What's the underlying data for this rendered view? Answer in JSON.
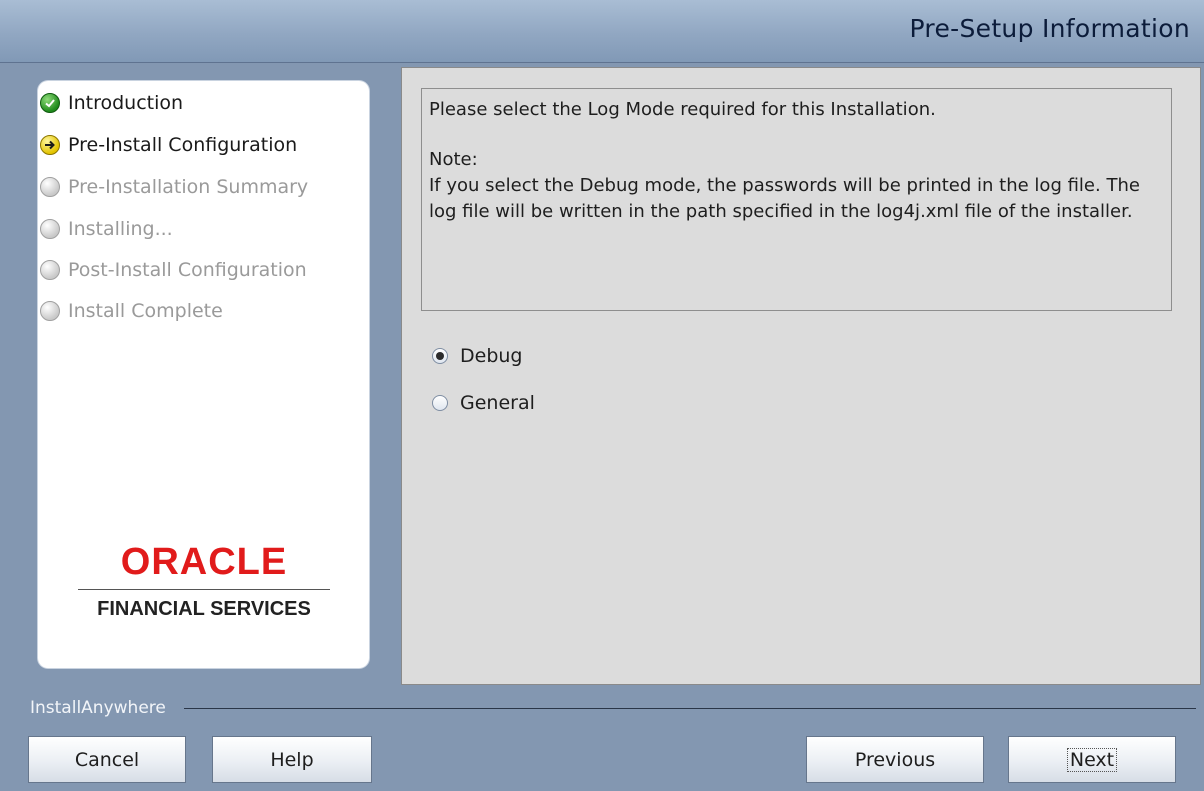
{
  "header": {
    "title": "Pre-Setup Information"
  },
  "steps": [
    {
      "label": "Introduction",
      "state": "done",
      "icon": "check-circle-icon"
    },
    {
      "label": "Pre-Install Configuration",
      "state": "current",
      "icon": "arrow-circle-icon"
    },
    {
      "label": "Pre-Installation Summary",
      "state": "pending",
      "icon": "empty-circle-icon"
    },
    {
      "label": "Installing...",
      "state": "pending",
      "icon": "empty-circle-icon"
    },
    {
      "label": "Post-Install Configuration",
      "state": "pending",
      "icon": "empty-circle-icon"
    },
    {
      "label": "Install Complete",
      "state": "pending",
      "icon": "empty-circle-icon"
    }
  ],
  "logo": {
    "brand": "ORACLE",
    "sub": "FINANCIAL SERVICES"
  },
  "info": {
    "line1": "Please select the Log Mode required for this Installation.",
    "note_heading": "Note:",
    "note_body": "If you select the Debug mode, the passwords will be printed in the log file. The log file will be written in the path specified in the log4j.xml file of the installer."
  },
  "log_mode": {
    "options": [
      {
        "label": "Debug",
        "selected": true
      },
      {
        "label": "General",
        "selected": false
      }
    ]
  },
  "footer": {
    "brand_label": "InstallAnywhere",
    "cancel_label": "Cancel",
    "help_label": "Help",
    "previous_label": "Previous",
    "next_label": "Next"
  },
  "colors": {
    "header_gradient_top": "#a9bdd4",
    "background": "#8397b1",
    "oracle_red": "#e11b1b",
    "step_done": "#1f8a1c",
    "step_current": "#e3c400"
  }
}
